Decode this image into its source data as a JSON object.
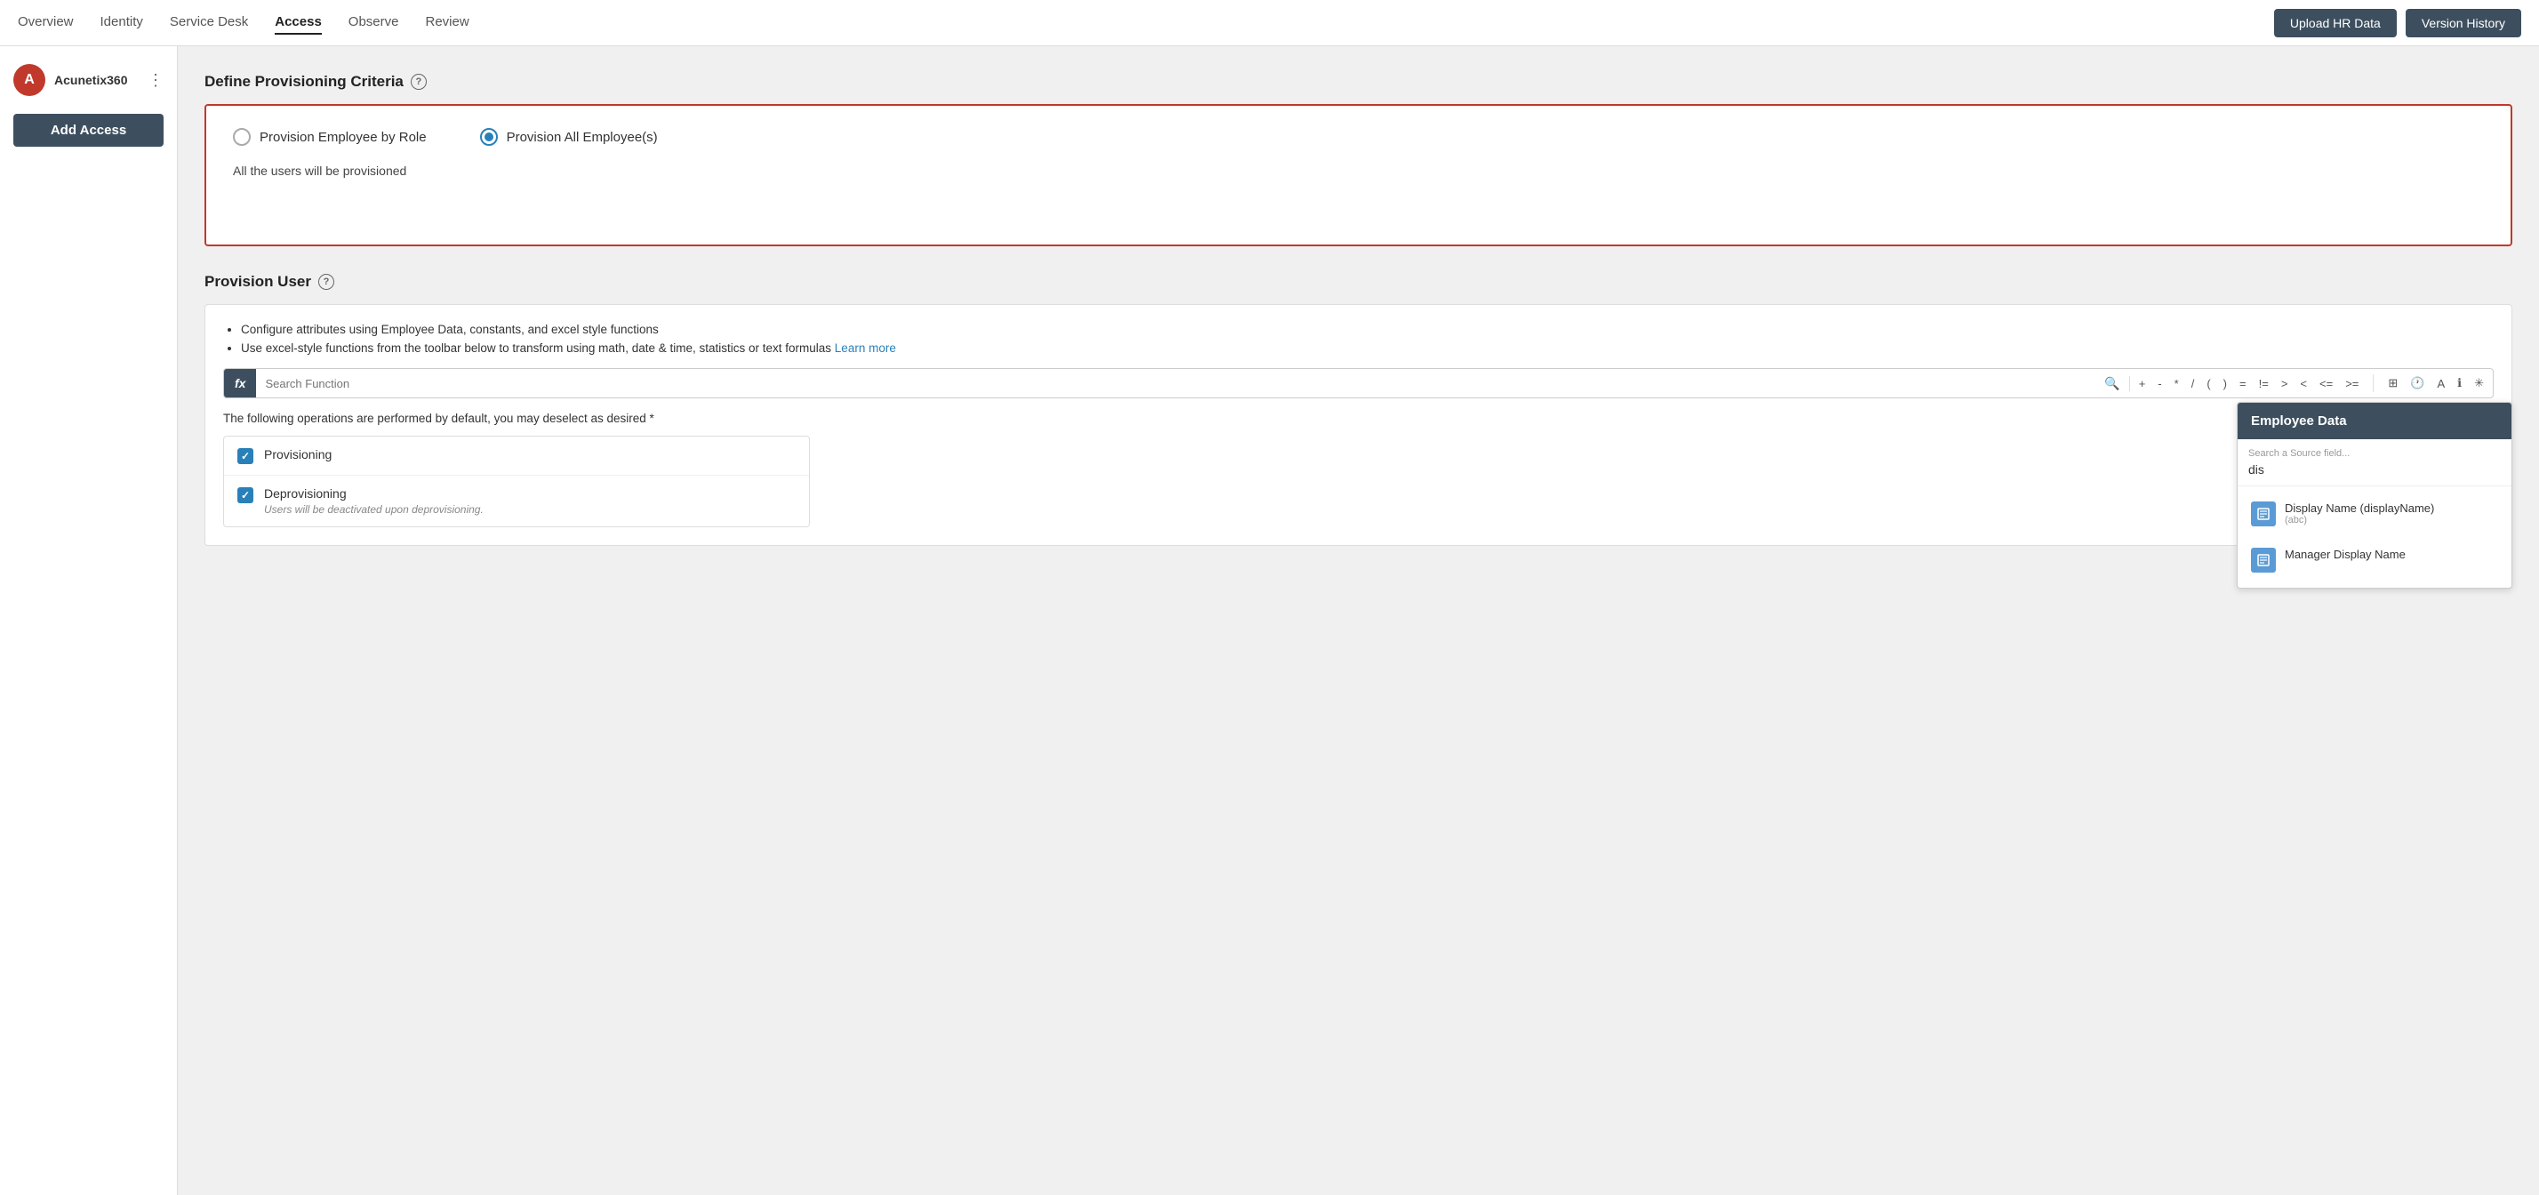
{
  "topNav": {
    "links": [
      {
        "label": "Overview",
        "active": false
      },
      {
        "label": "Identity",
        "active": false
      },
      {
        "label": "Service Desk",
        "active": false
      },
      {
        "label": "Access",
        "active": true
      },
      {
        "label": "Observe",
        "active": false
      },
      {
        "label": "Review",
        "active": false
      }
    ],
    "uploadBtn": "Upload HR Data",
    "versionBtn": "Version History"
  },
  "sidebar": {
    "appName": "Acunetix360",
    "logoLetter": "A",
    "addAccessBtn": "Add Access"
  },
  "defineSection": {
    "title": "Define Provisioning Criteria",
    "radioOptions": [
      {
        "label": "Provision Employee by Role",
        "selected": false
      },
      {
        "label": "Provision All Employee(s)",
        "selected": true
      }
    ],
    "description": "All the users will be provisioned"
  },
  "provisionSection": {
    "title": "Provision User",
    "bullets": [
      "Configure attributes using Employee Data, constants, and excel style functions",
      "Use excel-style functions from the toolbar below to transform using math, date & time, statistics or text formulas"
    ],
    "learnMoreText": "Learn more",
    "searchPlaceholder": "Search Function",
    "fxLabel": "fx",
    "toolbarOps": [
      "+",
      "-",
      "*",
      "/",
      "(",
      ")",
      "=",
      "!=",
      ">",
      "<",
      "<=",
      ">="
    ],
    "toolbarIcons": [
      "grid-icon",
      "clock-icon",
      "text-icon",
      "info-icon",
      "transform-icon"
    ],
    "operationsLabel": "The following operations are performed by default, you may deselect as desired *",
    "operations": [
      {
        "name": "Provisioning",
        "checked": true,
        "desc": ""
      },
      {
        "name": "Deprovisioning",
        "checked": true,
        "desc": "Users will be deactivated upon deprovisioning."
      }
    ]
  },
  "employeePanel": {
    "title": "Employee Data",
    "searchLabel": "Search a Source field...",
    "searchValue": "dis",
    "fields": [
      {
        "name": "Display Name (displayName)",
        "type": "(abc)",
        "iconBg": "#5b9bd5"
      },
      {
        "name": "Manager Display Name",
        "type": "",
        "iconBg": "#5b9bd5"
      }
    ]
  }
}
